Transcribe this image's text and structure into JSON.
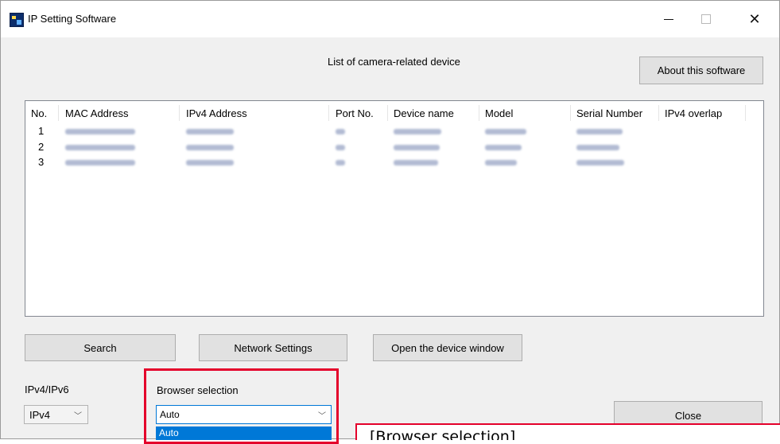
{
  "window": {
    "title": "IP Setting Software"
  },
  "header": {
    "list_title": "List of camera-related device",
    "about_label": "About this software"
  },
  "device_list": {
    "columns": [
      "No.",
      "MAC Address",
      "IPv4 Address",
      "Port No.",
      "Device name",
      "Model",
      "Serial Number",
      "IPv4 overlap"
    ],
    "rows": [
      {
        "no": "1"
      },
      {
        "no": "2"
      },
      {
        "no": "3"
      }
    ]
  },
  "actions": {
    "search_label": "Search",
    "network_settings_label": "Network Settings",
    "open_device_label": "Open the device window",
    "close_label": "Close"
  },
  "ip_version": {
    "label": "IPv4/IPv6",
    "selected": "IPv4"
  },
  "browser": {
    "label": "Browser selection",
    "selected": "Auto",
    "highlighted_option": "Auto"
  },
  "callout": {
    "text": "[Browser selection]"
  },
  "colors": {
    "highlight": "#e4002b",
    "selection": "#0078d7"
  }
}
